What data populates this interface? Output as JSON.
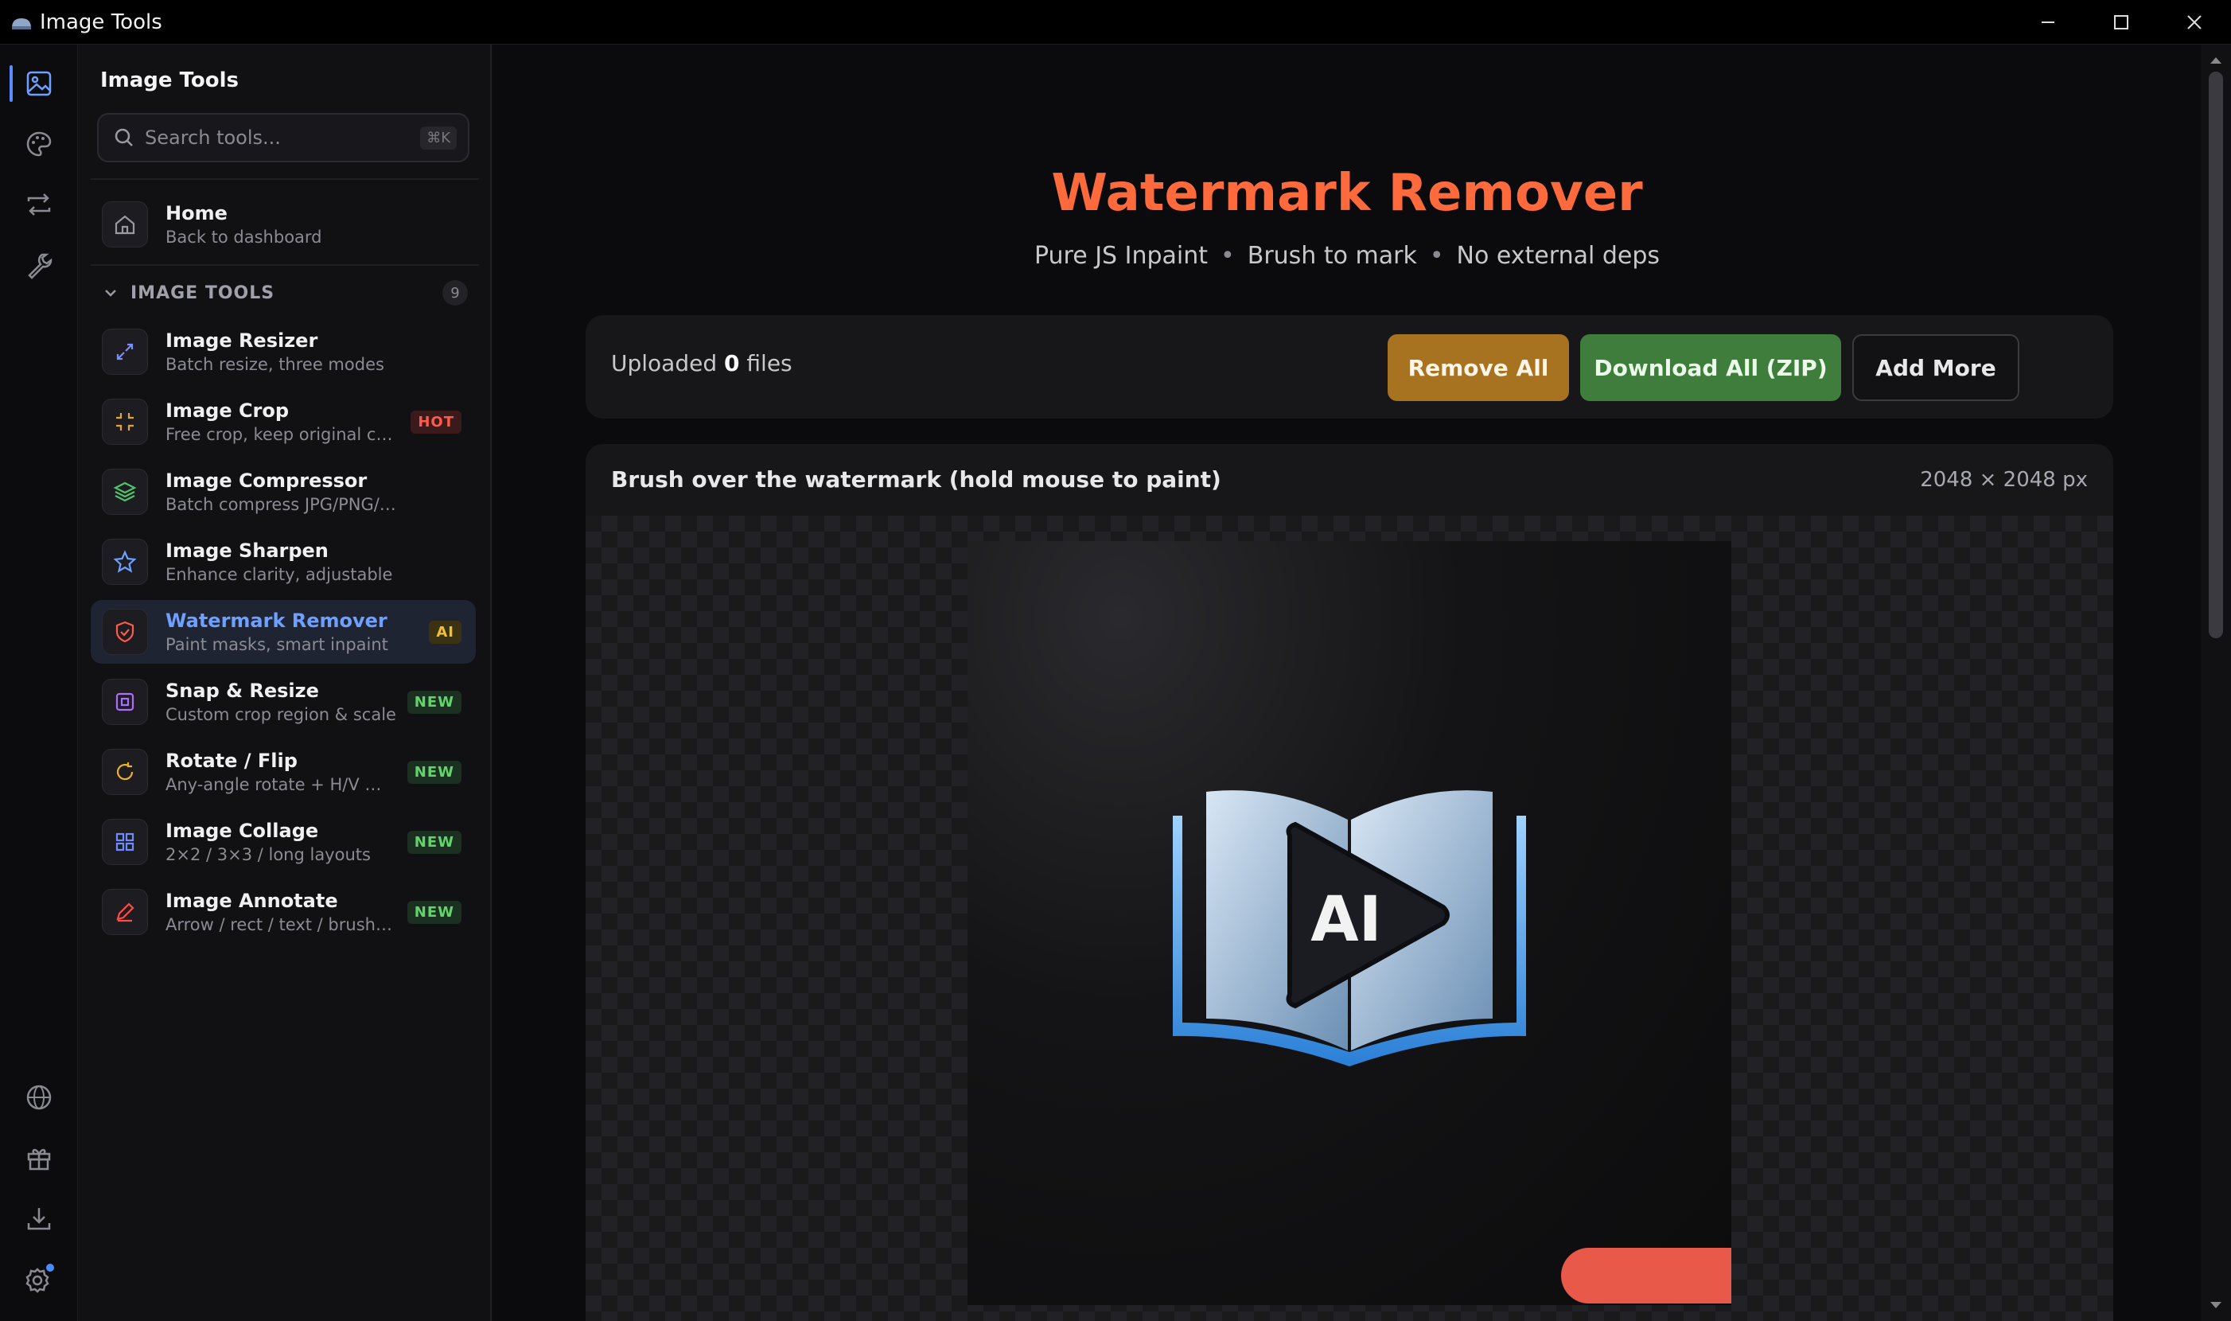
{
  "window": {
    "title": "Image Tools"
  },
  "rail": {
    "top": [
      "image-icon",
      "palette-icon",
      "convert-icon",
      "wrench-icon"
    ],
    "bottom": [
      "globe-icon",
      "gift-icon",
      "download-icon",
      "settings-icon"
    ]
  },
  "sidebar": {
    "title": "Image Tools",
    "search_placeholder": "Search tools...",
    "search_shortcut": "⌘K",
    "home": {
      "title": "Home",
      "subtitle": "Back to dashboard"
    },
    "section": {
      "label": "IMAGE TOOLS",
      "count": "9"
    },
    "tools": [
      {
        "title": "Image Resizer",
        "subtitle": "Batch resize, three modes",
        "badge": "",
        "icon": "resize-icon",
        "color": "#7b8cff"
      },
      {
        "title": "Image Crop",
        "subtitle": "Free crop, keep original clarity",
        "badge": "HOT",
        "icon": "crop-icon",
        "color": "#e8a23a"
      },
      {
        "title": "Image Compressor",
        "subtitle": "Batch compress JPG/PNG/WebP",
        "badge": "",
        "icon": "layers-icon",
        "color": "#4fc46a"
      },
      {
        "title": "Image Sharpen",
        "subtitle": "Enhance clarity, adjustable",
        "badge": "",
        "icon": "star-icon",
        "color": "#6fa0ff"
      },
      {
        "title": "Watermark Remover",
        "subtitle": "Paint masks, smart inpaint",
        "badge": "AI",
        "icon": "shield-icon",
        "color": "#ff5a4a"
      },
      {
        "title": "Snap & Resize",
        "subtitle": "Custom crop region & scale",
        "badge": "NEW",
        "icon": "snap-icon",
        "color": "#b06cff"
      },
      {
        "title": "Rotate / Flip",
        "subtitle": "Any-angle rotate + H/V mirror",
        "badge": "NEW",
        "icon": "rotate-icon",
        "color": "#f0b02a"
      },
      {
        "title": "Image Collage",
        "subtitle": "2×2 / 3×3 / long layouts",
        "badge": "NEW",
        "icon": "grid-icon",
        "color": "#6f8cff"
      },
      {
        "title": "Image Annotate",
        "subtitle": "Arrow / rect / text / brush / mosaic",
        "badge": "NEW",
        "icon": "pen-icon",
        "color": "#ff4a4a"
      }
    ]
  },
  "main": {
    "title": "Watermark Remover",
    "subtitle": [
      "Pure JS Inpaint",
      "Brush to mark",
      "No external deps"
    ],
    "uploaded_prefix": "Uploaded",
    "uploaded_count": "0",
    "uploaded_suffix": "files",
    "buttons": {
      "remove_all": "Remove All",
      "download_all": "Download All (ZIP)",
      "add_more": "Add More"
    },
    "editor": {
      "title": "Brush over the watermark (hold mouse to paint)",
      "dimensions": "2048 × 2048 px"
    },
    "image_text": "AI"
  },
  "colors": {
    "accent": "#ff6a3d",
    "active_nav": "#6fa0ff",
    "remove": "#a87321",
    "download": "#3f7d3c",
    "mask": "#e8594a"
  }
}
